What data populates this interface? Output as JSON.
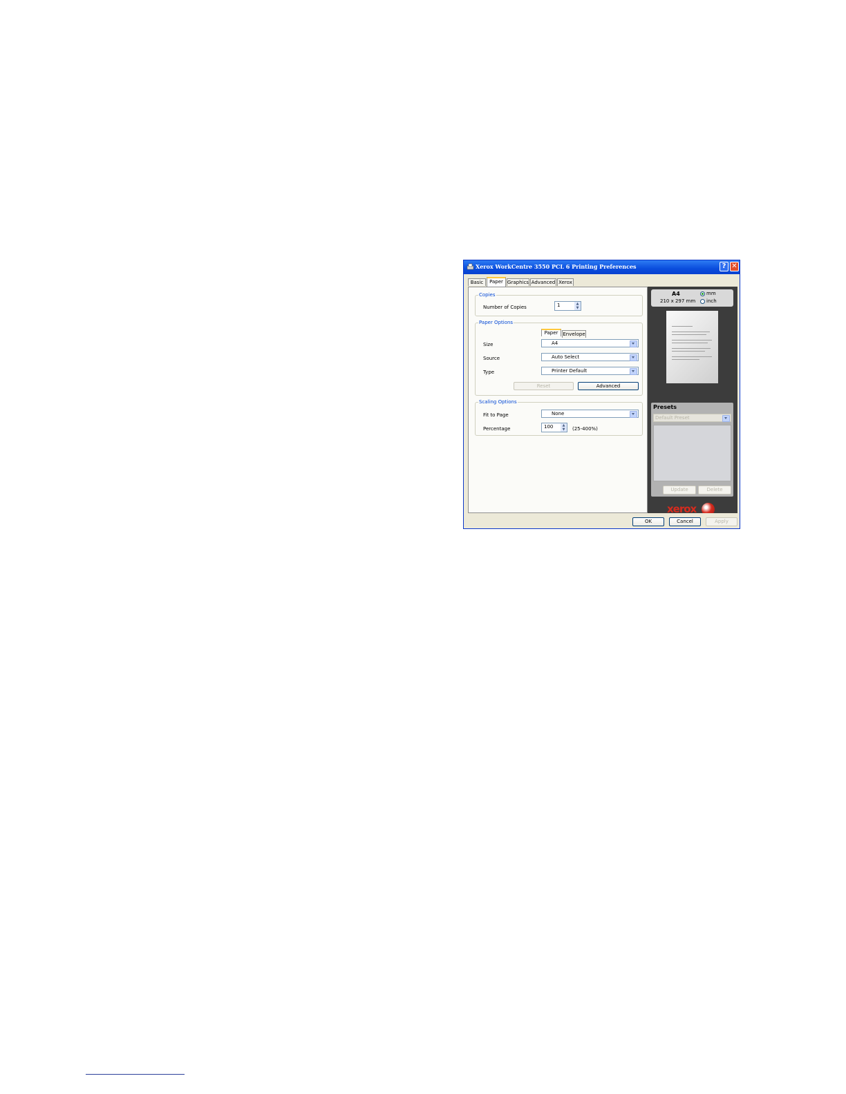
{
  "window": {
    "title": "Xerox WorkCentre 3550 PCL 6 Printing Preferences",
    "help_glyph": "?",
    "close_glyph": "✕"
  },
  "tabs": [
    {
      "label": "Basic"
    },
    {
      "label": "Paper",
      "active": true
    },
    {
      "label": "Graphics"
    },
    {
      "label": "Advanced"
    },
    {
      "label": "Xerox"
    }
  ],
  "copies": {
    "group_title": "Copies",
    "label": "Number of Copies",
    "value": "1"
  },
  "paper_options": {
    "group_title": "Paper Options",
    "subtabs": [
      {
        "label": "Paper",
        "active": true
      },
      {
        "label": "Envelope"
      }
    ],
    "size_label": "Size",
    "size_value": "A4",
    "source_label": "Source",
    "source_value": "Auto Select",
    "type_label": "Type",
    "type_value": "Printer Default",
    "reset_label": "Reset",
    "advanced_label": "Advanced"
  },
  "scaling_options": {
    "group_title": "Scaling Options",
    "fit_label": "Fit to Page",
    "fit_value": "None",
    "percentage_label": "Percentage",
    "percentage_value": "100",
    "percentage_range": "(25-400%)"
  },
  "paper_info": {
    "name": "A4",
    "dimensions": "210 x 297 mm",
    "unit_mm": "mm",
    "unit_inch": "inch",
    "selected_unit": "mm"
  },
  "presets": {
    "title": "Presets",
    "selected": "Default Preset",
    "update_label": "Update",
    "delete_label": "Delete"
  },
  "branding": {
    "logo_text": "xerox"
  },
  "footer": {
    "ok_label": "OK",
    "cancel_label": "Cancel",
    "apply_label": "Apply"
  },
  "colors": {
    "titlebar": "#0a4ddd",
    "group_title": "#0046d5",
    "right_panel": "#3c3c3c",
    "brand_red": "#d52b1e"
  }
}
